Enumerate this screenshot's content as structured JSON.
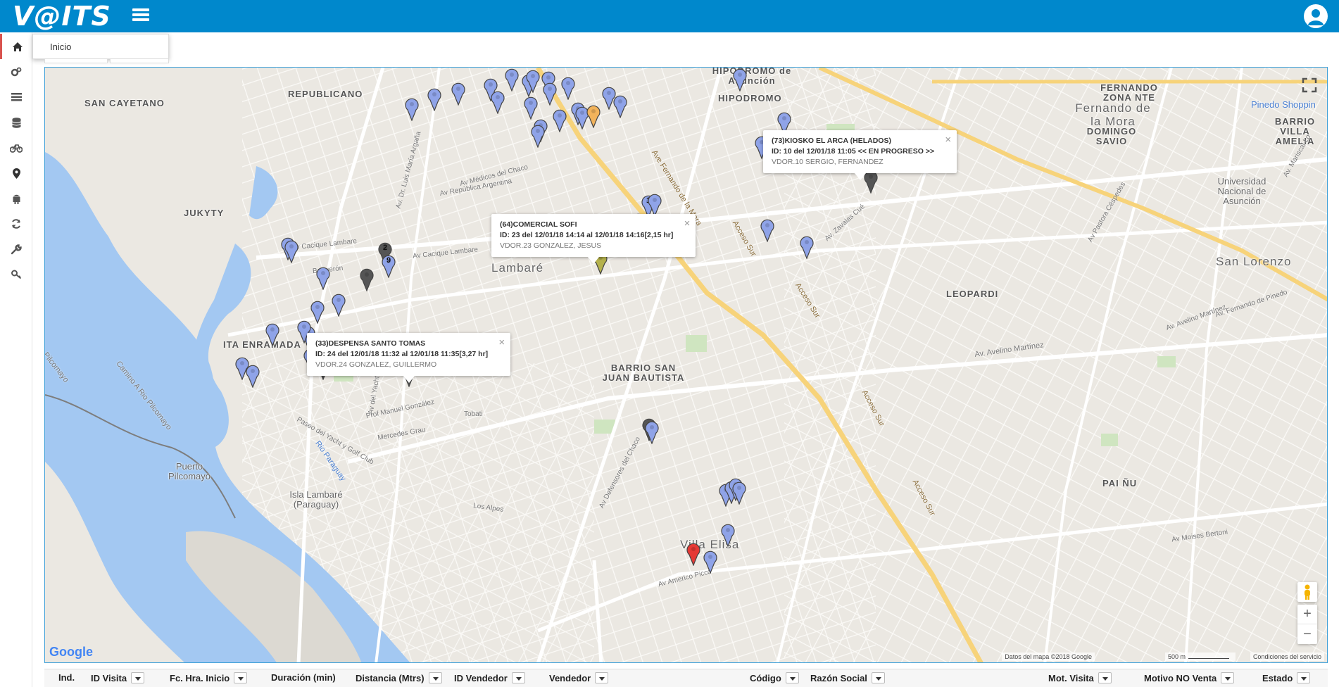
{
  "app": {
    "logo_text": "V@ITS",
    "theme_color": "#0088cc"
  },
  "menu": {
    "inicio_label": "Inicio"
  },
  "sidebar_icons": [
    "home-icon",
    "cogs-icon",
    "list-icon",
    "database-icon",
    "bicycle-icon",
    "map-marker-icon",
    "android-icon",
    "refresh-icon",
    "wrench-icon",
    "key-icon"
  ],
  "map": {
    "places": {
      "republicano": "REPUBLICANO",
      "san_cayetano": "SAN CAYETANO",
      "hipodromo_asuncion": "HIPODROMO de Asunción",
      "hipodromo": "HIPODROMO",
      "fernando_mora": "Fernando de la Mora",
      "fernando_zona_nte": "FERNANDO ZONA NTE",
      "domingo_savio": "DOMINGO SAVIO",
      "barrio_villa_amelia": "BARRIO VILLA AMELIA",
      "universidad": "Universidad Nacional de Asunción",
      "jukyty": "JUKYTY",
      "lambare": "Lambaré",
      "san_lorenzo": "San Lorenzo",
      "leopardi": "LEOPARDI",
      "ita_enramada": "ITA ENRAMADA",
      "barrio_san_juan": "BARRIO SAN JUAN BAUTISTA",
      "puerto_pilcomayo": "Puerto Pilcomayo",
      "isla_lambare": "Isla Lambaré (Paraguay)",
      "pai_nu": "PAI ÑU",
      "villa_elisa": "Villa Elisa",
      "pinedo": "Pinedo Shoppin",
      "rio_paraguay": "Rio Paraguay",
      "camino_pilcomayo": "Camino A Rio Pilcomayo",
      "pilcomayo": "Pilcomayo"
    },
    "roads": {
      "ave_fernando_mora": "Ave Fernando de la Mora",
      "acceso_sur": "Acceso Sur",
      "av_cacique": "Av Cacique Lambare",
      "av_republica_argentina": "Av República Argentina",
      "av_medicos_chaco": "Av Médicos del Chaco",
      "av_avelino_martinez": "Av. Avelino Martínez",
      "av_defensores": "Av Defensores del Chaco",
      "av_fernando_pinedo": "Av. Fernando de Pinedo",
      "av_mcal_lopez": "Av. Mariscal Lo",
      "av_americo_picco": "Av Americo Picco",
      "av_moises_bertoni": "Av Moises Bertoni",
      "av_pastora": "Av Pastora Céspedes",
      "av_zavalas": "Av. Zavalas Cué",
      "av_del_yacht": "Av del Yacht",
      "boqueron": "Boquerón",
      "mercedes_grau": "Mercedes Grau",
      "prof_manuel_gonzalez": "Prof Manuel González",
      "paseo_yacht": "Paseo del Yacht y Golf Club",
      "tobati": "Tobati",
      "los_alpes": "Los Alpes",
      "avda_luis": "Av. Dr. Luis María Argaña"
    },
    "info_windows": [
      {
        "title": "(73)KIOSKO EL ARCA (HELADOS)",
        "line2": "ID: 10 del 12/01/18 11:05 << EN PROGRESO >>",
        "line3": "VDOR.10 SERGIO, FERNANDEZ"
      },
      {
        "title": "(64)COMERCIAL SOFI",
        "line2": "ID: 23 del 12/01/18 14:14 al 12/01/18 14:16[2,15 hr]",
        "line3": "VDOR.23 GONZALEZ, JESUS"
      },
      {
        "title": "(33)DESPENSA SANTO TOMAS",
        "line2": "ID: 24 del 12/01/18 11:32 al 12/01/18 11:35[3,27 hr]",
        "line3": "VDOR.24 GONZALEZ, GUILLERMO"
      }
    ],
    "pin_labels": {
      "p1": "1",
      "p2": "2",
      "p9": "9"
    },
    "close_glyph": "×",
    "google_logo": "Google",
    "attribution": "Datos del mapa ©2018 Google",
    "scale": "500 m",
    "terms": "Condiciones del servicio",
    "zoom_in": "+",
    "zoom_out": "−",
    "pin_colors": {
      "blue": "#8fa3e8",
      "orange": "#f2b35b",
      "red": "#e53935",
      "dark": "#555555",
      "olive": "#b5b24d"
    }
  },
  "grid": {
    "columns": [
      "Ind.",
      "ID Visita",
      "Fc. Hra. Inicio",
      "Duración (min)",
      "Distancia (Mtrs)",
      "ID Vendedor",
      "Vendedor",
      "Código",
      "Razón Social",
      "Mot. Visita",
      "Motivo NO Venta",
      "Estado"
    ]
  }
}
